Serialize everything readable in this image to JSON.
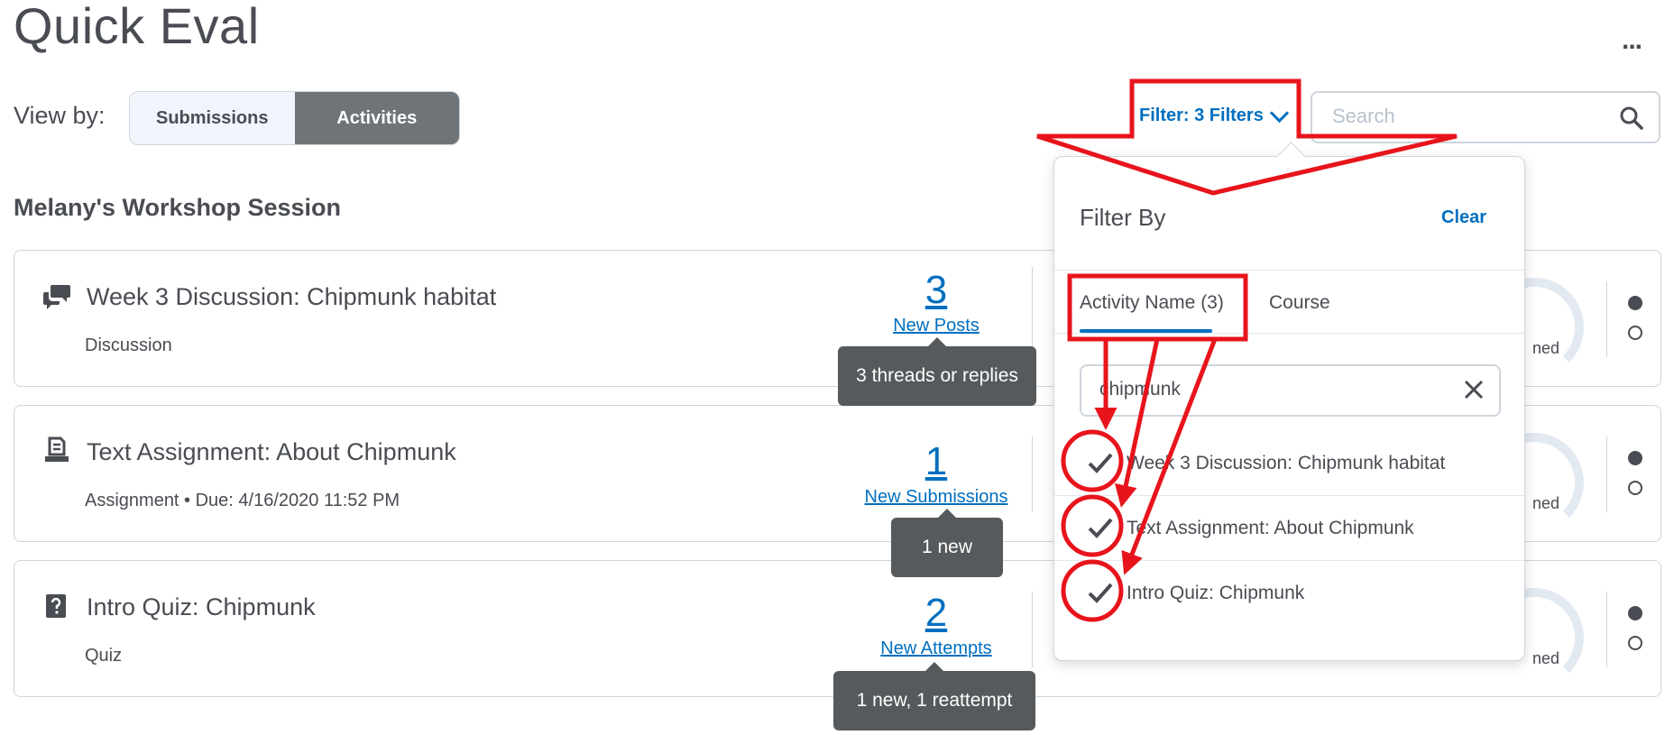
{
  "header": {
    "title": "Quick Eval",
    "more_label": "..."
  },
  "view_by": {
    "label": "View by:",
    "options": [
      "Submissions",
      "Activities"
    ],
    "selected": "Activities"
  },
  "filter": {
    "button_label": "Filter: 3 Filters"
  },
  "search": {
    "placeholder": "Search"
  },
  "section": {
    "title": "Melany's Workshop Session"
  },
  "activities": [
    {
      "icon": "discussion-icon",
      "title": "Week 3 Discussion: Chipmunk habitat",
      "subtitle": "Discussion",
      "count": "3",
      "count_label": "New Posts",
      "tooltip": "3 threads or replies",
      "partial_stat": "ned"
    },
    {
      "icon": "assignment-icon",
      "title": "Text Assignment: About Chipmunk",
      "subtitle": "Assignment • Due: 4/16/2020 11:52 PM",
      "count": "1",
      "count_label": "New Submissions",
      "tooltip": "1 new",
      "partial_stat": "ned"
    },
    {
      "icon": "quiz-icon",
      "title": "Intro Quiz: Chipmunk",
      "subtitle": "Quiz",
      "count": "2",
      "count_label": "New Attempts",
      "tooltip": "1 new, 1 reattempt",
      "partial_stat": "ned"
    }
  ],
  "filter_panel": {
    "title": "Filter By",
    "clear_label": "Clear",
    "tabs": [
      "Activity Name (3)",
      "Course"
    ],
    "active_tab": "Activity Name (3)",
    "search_value": "chipmunk",
    "options": [
      {
        "label": "Week 3 Discussion: Chipmunk habitat",
        "checked": true
      },
      {
        "label": "Text Assignment: About Chipmunk",
        "checked": true
      },
      {
        "label": "Intro Quiz: Chipmunk",
        "checked": true
      }
    ]
  },
  "colors": {
    "accent": "#006fbf",
    "annotation": "#e8141c",
    "text": "#494c52",
    "tooltip_bg": "#565a5c"
  }
}
